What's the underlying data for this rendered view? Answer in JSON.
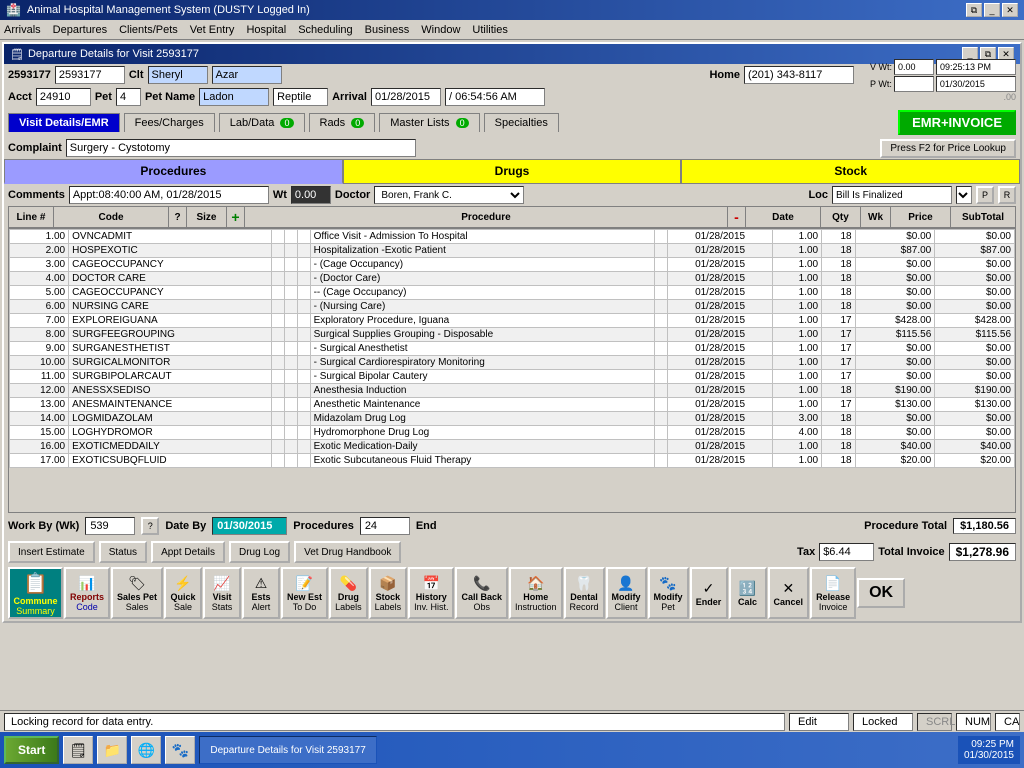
{
  "app": {
    "title": "Animal Hospital Management System (DUSTY Logged In)",
    "window_controls": [
      "restore",
      "minimize",
      "close"
    ]
  },
  "menu": {
    "items": [
      "Arrivals",
      "Departures",
      "Clients/Pets",
      "Vet Entry",
      "Hospital",
      "Scheduling",
      "Business",
      "Window",
      "Utilities"
    ]
  },
  "window": {
    "title": "Departure Details for Visit 2593177",
    "visit": "2593177",
    "client_label": "Clt",
    "client_name": "Sheryl",
    "last_name": "Azar",
    "home_label": "Home",
    "home_phone": "(201) 343-8117",
    "vwt_label": "V Wt:",
    "vwt_value": "0.00",
    "pwt_label": "P Wt:",
    "pwt_value": "",
    "time1": "09:25:13 PM",
    "time2": "01/30/2015",
    "acct_label": "Acct",
    "acct_value": "24910",
    "pet_label": "Pet",
    "pet_value": "4",
    "pet_name_label": "Pet Name",
    "pet_name": "Ladon",
    "species": "Reptile",
    "arrival_label": "Arrival",
    "arrival_date": "01/28/2015",
    "arrival_time": "/ 06:54:56 AM"
  },
  "tabs": {
    "items": [
      {
        "label": "Visit Details/EMR",
        "active": true
      },
      {
        "label": "Fees/Charges",
        "active": false
      },
      {
        "label": "Lab/Data",
        "active": false,
        "badge": "0"
      },
      {
        "label": "Rads",
        "active": false,
        "badge": "0"
      },
      {
        "label": "Master Lists",
        "active": false,
        "badge": "0"
      },
      {
        "label": "Specialties",
        "active": false
      }
    ],
    "emr_button": "EMR+INVOICE"
  },
  "complaint": {
    "label": "Complaint",
    "value": "Surgery - Cystotomy",
    "f2_text": "Press F2 for Price Lookup"
  },
  "sub_tabs": [
    {
      "label": "Procedures",
      "type": "proc"
    },
    {
      "label": "Drugs",
      "type": "drug"
    },
    {
      "label": "Stock",
      "type": "stock"
    }
  ],
  "cwt": {
    "comments_label": "Comments",
    "comments_value": "Appt:08:40:00 AM, 01/28/2015",
    "wt_label": "Wt",
    "wt_value": "0.00",
    "doctor_label": "Doctor",
    "doctor_value": "Boren, Frank C.",
    "loc_label": "Loc",
    "loc_value": "Bill Is Finalized"
  },
  "table": {
    "headers": [
      "Line #",
      "Code",
      "?",
      "Size",
      "+",
      "Procedure",
      "-",
      "Date",
      "Qty",
      "Wk",
      "Price",
      "SubTotal"
    ],
    "rows": [
      {
        "line": "1.00",
        "code": "OVNCADMIT",
        "size": "",
        "procedure": "Office Visit - Admission To Hospital",
        "date": "01/28/2015",
        "qty": "1.00",
        "wk": "18",
        "price": "$0.00",
        "subtotal": "$0.00"
      },
      {
        "line": "2.00",
        "code": "HOSPEXOTIC",
        "size": "",
        "procedure": "Hospitalization -Exotic Patient",
        "date": "01/28/2015",
        "qty": "1.00",
        "wk": "18",
        "price": "$87.00",
        "subtotal": "$87.00"
      },
      {
        "line": "3.00",
        "code": "CAGEOCCUPANCY",
        "size": "",
        "procedure": "- (Cage Occupancy)",
        "date": "01/28/2015",
        "qty": "1.00",
        "wk": "18",
        "price": "$0.00",
        "subtotal": "$0.00"
      },
      {
        "line": "4.00",
        "code": "DOCTOR CARE",
        "size": "",
        "procedure": "- (Doctor Care)",
        "date": "01/28/2015",
        "qty": "1.00",
        "wk": "18",
        "price": "$0.00",
        "subtotal": "$0.00"
      },
      {
        "line": "5.00",
        "code": "CAGEOCCUPANCY",
        "size": "",
        "procedure": "-- (Cage Occupancy)",
        "date": "01/28/2015",
        "qty": "1.00",
        "wk": "18",
        "price": "$0.00",
        "subtotal": "$0.00"
      },
      {
        "line": "6.00",
        "code": "NURSING CARE",
        "size": "",
        "procedure": "- (Nursing Care)",
        "date": "01/28/2015",
        "qty": "1.00",
        "wk": "18",
        "price": "$0.00",
        "subtotal": "$0.00"
      },
      {
        "line": "7.00",
        "code": "EXPLOREIGUANA",
        "size": "",
        "procedure": "Exploratory Procedure, Iguana",
        "date": "01/28/2015",
        "qty": "1.00",
        "wk": "17",
        "price": "$428.00",
        "subtotal": "$428.00"
      },
      {
        "line": "8.00",
        "code": "SURGFEEGROUPING",
        "size": "",
        "procedure": "Surgical Supplies Grouping - Disposable",
        "date": "01/28/2015",
        "qty": "1.00",
        "wk": "17",
        "price": "$115.56",
        "subtotal": "$115.56"
      },
      {
        "line": "9.00",
        "code": "SURGANESTHETIST",
        "size": "",
        "procedure": "- Surgical Anesthetist",
        "date": "01/28/2015",
        "qty": "1.00",
        "wk": "17",
        "price": "$0.00",
        "subtotal": "$0.00"
      },
      {
        "line": "10.00",
        "code": "SURGICALMONITOR",
        "size": "",
        "procedure": "- Surgical Cardiorespiratory Monitoring",
        "date": "01/28/2015",
        "qty": "1.00",
        "wk": "17",
        "price": "$0.00",
        "subtotal": "$0.00"
      },
      {
        "line": "11.00",
        "code": "SURGBIPOLARCAUT",
        "size": "",
        "procedure": "- Surgical Bipolar Cautery",
        "date": "01/28/2015",
        "qty": "1.00",
        "wk": "17",
        "price": "$0.00",
        "subtotal": "$0.00"
      },
      {
        "line": "12.00",
        "code": "ANESSXSEDISO",
        "size": "",
        "procedure": "Anesthesia Induction",
        "date": "01/28/2015",
        "qty": "1.00",
        "wk": "18",
        "price": "$190.00",
        "subtotal": "$190.00"
      },
      {
        "line": "13.00",
        "code": "ANESMAINTENANCE",
        "size": "",
        "procedure": "Anesthetic Maintenance",
        "date": "01/28/2015",
        "qty": "1.00",
        "wk": "17",
        "price": "$130.00",
        "subtotal": "$130.00"
      },
      {
        "line": "14.00",
        "code": "LOGMIDAZOLAM",
        "size": "",
        "procedure": "Midazolam Drug Log",
        "date": "01/28/2015",
        "qty": "3.00",
        "wk": "18",
        "price": "$0.00",
        "subtotal": "$0.00"
      },
      {
        "line": "15.00",
        "code": "LOGHYDROMOR",
        "size": "",
        "procedure": "Hydromorphone Drug Log",
        "date": "01/28/2015",
        "qty": "4.00",
        "wk": "18",
        "price": "$0.00",
        "subtotal": "$0.00"
      },
      {
        "line": "16.00",
        "code": "EXOTICMEDDAILY",
        "size": "",
        "procedure": "Exotic Medication-Daily",
        "date": "01/28/2015",
        "qty": "1.00",
        "wk": "18",
        "price": "$40.00",
        "subtotal": "$40.00"
      },
      {
        "line": "17.00",
        "code": "EXOTICSUBQFLUID",
        "size": "",
        "procedure": "Exotic Subcutaneous Fluid Therapy",
        "date": "01/28/2015",
        "qty": "1.00",
        "wk": "18",
        "price": "$20.00",
        "subtotal": "$20.00"
      }
    ]
  },
  "summary": {
    "work_by_label": "Work By (Wk)",
    "work_by_value": "539",
    "date_by_label": "Date By",
    "date_by_value": "01/30/2015",
    "procedures_label": "Procedures",
    "procedures_value": "24",
    "end_label": "End",
    "proc_total_label": "Procedure Total",
    "proc_total_value": "$1,180.56"
  },
  "invoice": {
    "tax_label": "Tax",
    "tax_value": "$6.44",
    "total_label": "Total Invoice",
    "total_value": "$1,278.96"
  },
  "btn_row1": {
    "insert_estimate": "Insert Estimate",
    "status": "Status",
    "appt_details": "Appt Details",
    "drug_log": "Drug Log",
    "vet_drug_handbook": "Vet Drug Handbook"
  },
  "action_buttons": [
    {
      "label": "Commune",
      "sub": "Summary",
      "icon": "📋",
      "type": "icon-text"
    },
    {
      "label": "Reports",
      "sub": "Code",
      "icon": "📊"
    },
    {
      "label": "Sales Pet",
      "sub": "Sales",
      "icon": "🏷"
    },
    {
      "label": "Quick",
      "sub": "Sale",
      "icon": "⚡"
    },
    {
      "label": "Visit",
      "sub": "Stats",
      "icon": "📈"
    },
    {
      "label": "Ests",
      "sub": "Alert",
      "icon": "⚠"
    },
    {
      "label": "New Est",
      "sub": "To Do",
      "icon": "📝"
    },
    {
      "label": "Drug",
      "sub": "Labels",
      "icon": "💊"
    },
    {
      "label": "Stock",
      "sub": "Labels",
      "icon": "📦"
    },
    {
      "label": "History",
      "sub": "Inv. Hist.",
      "icon": "📅"
    },
    {
      "label": "Call Back",
      "sub": "Obs",
      "icon": "📞"
    },
    {
      "label": "Home",
      "sub": "Instruction",
      "icon": "🏠"
    },
    {
      "label": "Dental",
      "sub": "Record",
      "icon": "🦷"
    },
    {
      "label": "Modify",
      "sub": "Client",
      "icon": "👤"
    },
    {
      "label": "Modify",
      "sub": "Pet",
      "icon": "🐾"
    },
    {
      "label": "Ender",
      "sub": "",
      "icon": "✓"
    },
    {
      "label": "Calc",
      "sub": "",
      "icon": "🔢"
    },
    {
      "label": "Cancel",
      "sub": "",
      "icon": "✕"
    },
    {
      "label": "Release",
      "sub": "Invoice",
      "icon": "📄"
    },
    {
      "label": "OK",
      "sub": "",
      "icon": ""
    }
  ],
  "status": {
    "message": "Locking record for data entry.",
    "edit": "Edit",
    "locked": "Locked",
    "scrl": "SCRL",
    "num": "NUM",
    "ca": "CA"
  },
  "taskbar": {
    "start": "Start",
    "app_label": "Departure Details for Visit 2593177",
    "time": "09:25 PM",
    "date": "01/30/2015"
  }
}
